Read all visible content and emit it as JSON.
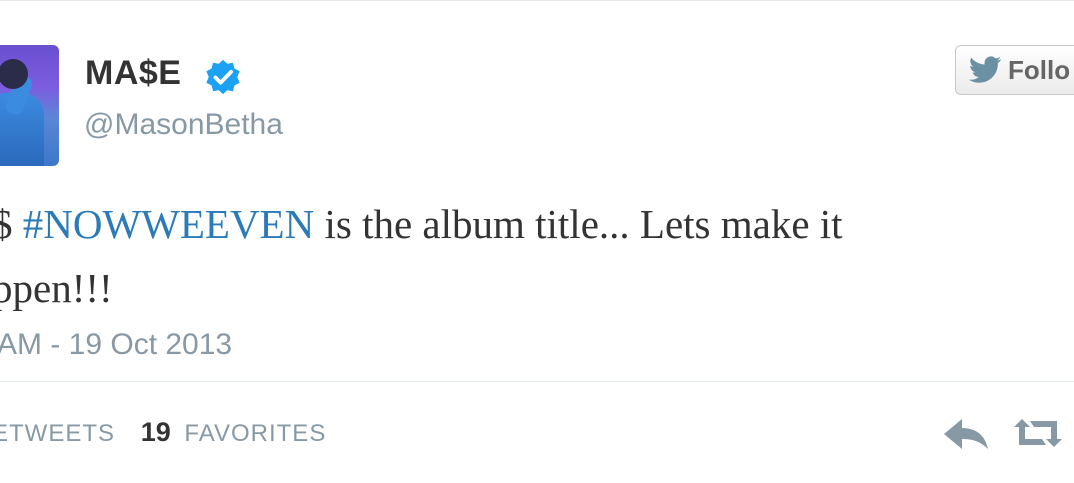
{
  "user": {
    "display_name": "MA$E",
    "handle": "@MasonBetha",
    "verified": true
  },
  "follow_button": {
    "label": "Follo"
  },
  "tweet": {
    "line1_prefix": "$ ",
    "hashtag": "#NOWWEEVEN",
    "line1_suffix": " is the album title... Lets make it",
    "line2": "ppen!!!"
  },
  "timestamp": "AM - 19 Oct 2013",
  "stats": {
    "retweets_label": "ETWEETS",
    "favorites_count": "19",
    "favorites_label": "FAVORITES"
  },
  "icons": {
    "verified": "verified-badge-icon",
    "follow": "twitter-bird-icon",
    "reply": "reply-icon",
    "retweet": "retweet-icon"
  },
  "colors": {
    "link": "#2b7bb9",
    "verified": "#1da1f2",
    "muted": "#8899a6",
    "text": "#333333"
  }
}
